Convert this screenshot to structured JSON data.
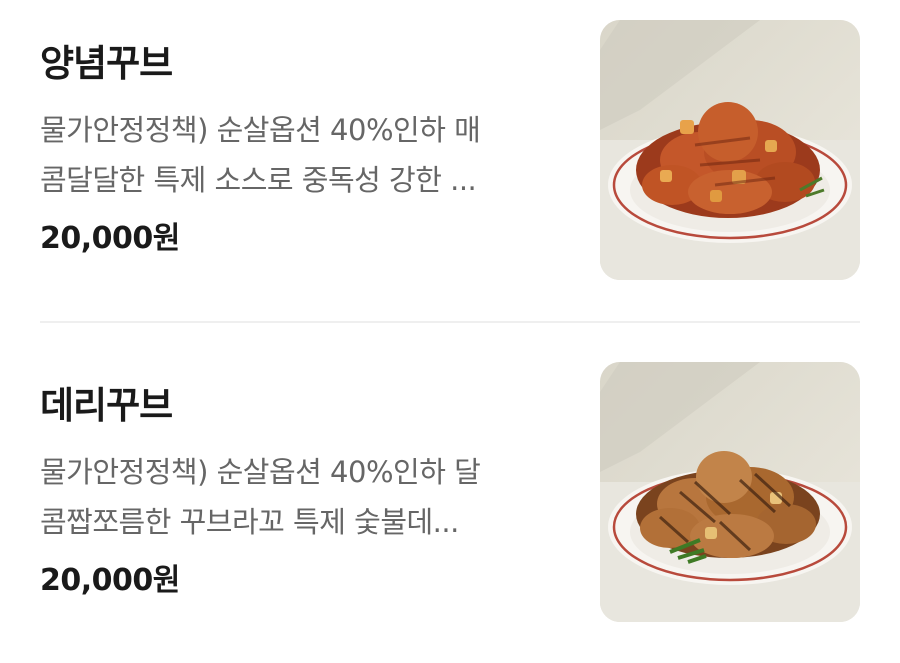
{
  "menu": {
    "items": [
      {
        "name": "양념꾸브",
        "desc_line1": "물가안정정책) 순살옵션 40%인하 매",
        "desc_line2": "콤달달한 특제 소스로 중독성 강한 ...",
        "price": "20,000원",
        "image_alt": "양념꾸브 dish photo"
      },
      {
        "name": "데리꾸브",
        "desc_line1": "물가안정정책) 순살옵션 40%인하 달",
        "desc_line2": "콤짭쪼름한 꾸브라꼬 특제 숯불데...",
        "price": "20,000원",
        "image_alt": "데리꾸브 dish photo"
      }
    ]
  },
  "colors": {
    "title": "#1a1a1a",
    "description": "#666666",
    "divider": "#efefef",
    "photo_background": "#e4e1d6",
    "plate_rim": "#b84a3c",
    "yangnyeom_sauce": "#c4572a",
    "deri_glaze": "#b8763e"
  }
}
